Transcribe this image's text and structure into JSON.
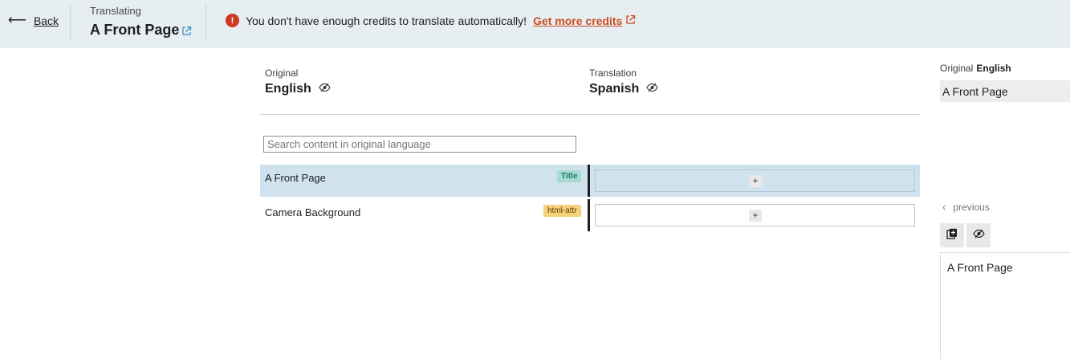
{
  "header": {
    "back_label": "Back",
    "translating_label": "Translating",
    "page_title": "A Front Page",
    "notice_text": "You don't have enough credits to translate automatically!",
    "notice_link": "Get more credits",
    "error_glyph": "!"
  },
  "languages": {
    "original_caption": "Original",
    "original_name": "English",
    "translation_caption": "Translation",
    "translation_name": "Spanish"
  },
  "search": {
    "placeholder": "Search content in original language"
  },
  "rows": [
    {
      "source": "A Front Page",
      "tag": "Title",
      "add_symbol": "+"
    },
    {
      "source": "Camera Background",
      "tag": "html-attr",
      "add_symbol": "+"
    }
  ],
  "right_panel": {
    "original_caption": "Original",
    "original_language": "English",
    "original_text": "A Front Page",
    "previous_label": "previous",
    "translation_text": "A Front Page"
  },
  "colors": {
    "header_bg": "#e6eef2",
    "error_red": "#cc3a1f",
    "link_orange": "#d04a1f",
    "selected_row": "#cfe2ee",
    "title_tag": "#a9dbd2",
    "attr_tag": "#f7d27c"
  },
  "icons": [
    "arrow-left-icon",
    "external-link-icon",
    "error-icon",
    "eye-slash-icon",
    "plus-icon",
    "chevron-left-icon",
    "copy-icon"
  ]
}
